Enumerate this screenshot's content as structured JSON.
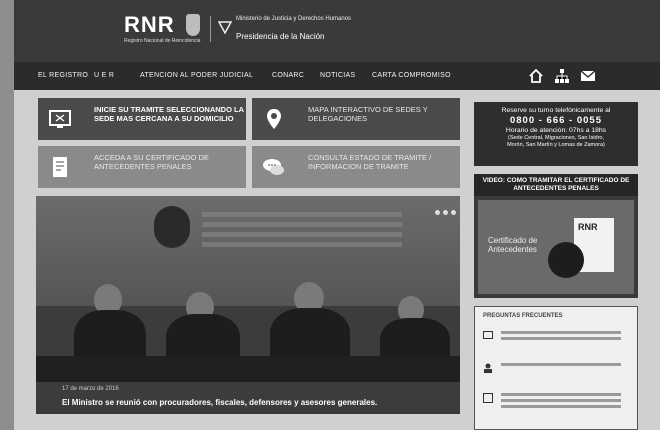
{
  "header": {
    "logo": "RNR",
    "logo_subtitle": "Registro Nacional de Reincidencia",
    "ministry": "Ministerio de Justicia y Derechos Humanos",
    "presidency": "Presidencia de la Nación"
  },
  "nav": {
    "items": [
      "EL REGISTRO",
      "U E R",
      "ATENCION AL PODER JUDICIAL",
      "CONARC",
      "NOTICIAS",
      "CARTA COMPROMISO"
    ],
    "icons": [
      "home-icon",
      "sitemap-icon",
      "mail-icon"
    ]
  },
  "tiles": [
    {
      "text": "INICIE SU TRAMITE SELECCIONANDO LA SEDE MAS CERCANA A SU DOMICILIO",
      "icon": "monitor-icon"
    },
    {
      "text": "MAPA INTERACTIVO DE SEDES Y DELEGACIONES",
      "icon": "location-pin-icon"
    },
    {
      "text": "ACCEDA A SU CERTIFICADO DE ANTECEDENTES PENALES",
      "icon": "certificate-icon"
    },
    {
      "text": "CONSULTA ESTADO DE TRAMITE / INFORMACION DE TRAMITE",
      "icon": "chat-icon"
    }
  ],
  "slider": {
    "date": "17 de marzo de 2016",
    "caption": "El Ministro se reunió con procuradores, fiscales, defensores y asesores generales."
  },
  "turno": {
    "line1": "Reserve su turno telefónicamente al",
    "phone": "0800 - 666 - 0055",
    "hours": "Horario de atención: 07hs a 18hs",
    "sedes1": "(Sede Central, Migraciones, San Isidro,",
    "sedes2": "Morón, San Martín y Lomas de Zamora)"
  },
  "video": {
    "title": "VIDEO: COMO TRAMITAR EL CERTIFICADO DE ANTECEDENTES PENALES",
    "caption_line1": "Certificado de",
    "caption_line2": "Antecedentes",
    "card_label": "RNR"
  },
  "faq": {
    "title": "PREGUNTAS FRECUENTES"
  }
}
